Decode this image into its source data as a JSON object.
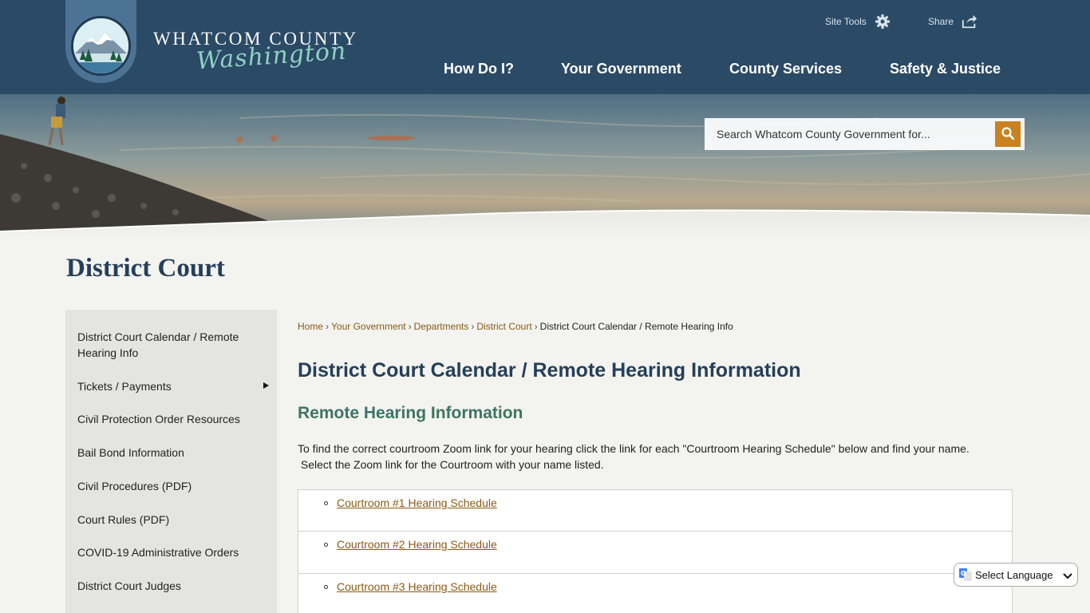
{
  "header": {
    "brand_top": "WHATCOM COUNTY",
    "brand_script": "Washington",
    "site_tools_label": "Site Tools",
    "share_label": "Share",
    "nav": [
      {
        "label": "How Do I?"
      },
      {
        "label": "Your Government"
      },
      {
        "label": "County Services"
      },
      {
        "label": "Safety & Justice"
      }
    ]
  },
  "search": {
    "placeholder": "Search Whatcom County Government for..."
  },
  "page_title": "District Court",
  "sidebar": {
    "items": [
      {
        "label": "District Court Calendar / Remote Hearing Info",
        "has_submenu": false
      },
      {
        "label": "Tickets / Payments",
        "has_submenu": true
      },
      {
        "label": "Civil Protection Order Resources",
        "has_submenu": false
      },
      {
        "label": "Bail Bond Information",
        "has_submenu": false
      },
      {
        "label": "Civil Procedures (PDF)",
        "has_submenu": false
      },
      {
        "label": "Court Rules (PDF)",
        "has_submenu": false
      },
      {
        "label": "COVID-19 Administrative Orders",
        "has_submenu": false
      },
      {
        "label": "District Court Judges",
        "has_submenu": false
      }
    ]
  },
  "breadcrumb": {
    "items": [
      {
        "label": "Home"
      },
      {
        "label": "Your Government"
      },
      {
        "label": "Departments"
      },
      {
        "label": "District Court"
      }
    ],
    "current": "District Court Calendar / Remote Hearing Info",
    "separator": "›"
  },
  "content": {
    "heading": "District Court Calendar / Remote Hearing Information",
    "subheading": "Remote Hearing Information",
    "intro_line1": "To find the correct courtroom Zoom link for your hearing click the link for each \"Courtroom Hearing Schedule\" below and find your name.",
    "intro_line2": " Select the Zoom link for the Courtroom with your name listed.",
    "schedules": [
      {
        "label": "Courtroom #1 Hearing Schedule"
      },
      {
        "label": "Courtroom #2 Hearing Schedule"
      },
      {
        "label": "Courtroom #3 Hearing Schedule"
      }
    ]
  },
  "language": {
    "label": "Select Language"
  },
  "colors": {
    "header_bg": "#2b4a66",
    "heading": "#243f5a",
    "subheading": "#3d7465",
    "link": "#8a5a14",
    "search_button": "#c8821f",
    "accent_script": "#8fd1c3"
  },
  "icons": {
    "site_tools": "gear-icon",
    "share": "share-icon",
    "search": "search-icon",
    "submenu": "caret-right-icon",
    "translate": "google-translate-icon"
  }
}
